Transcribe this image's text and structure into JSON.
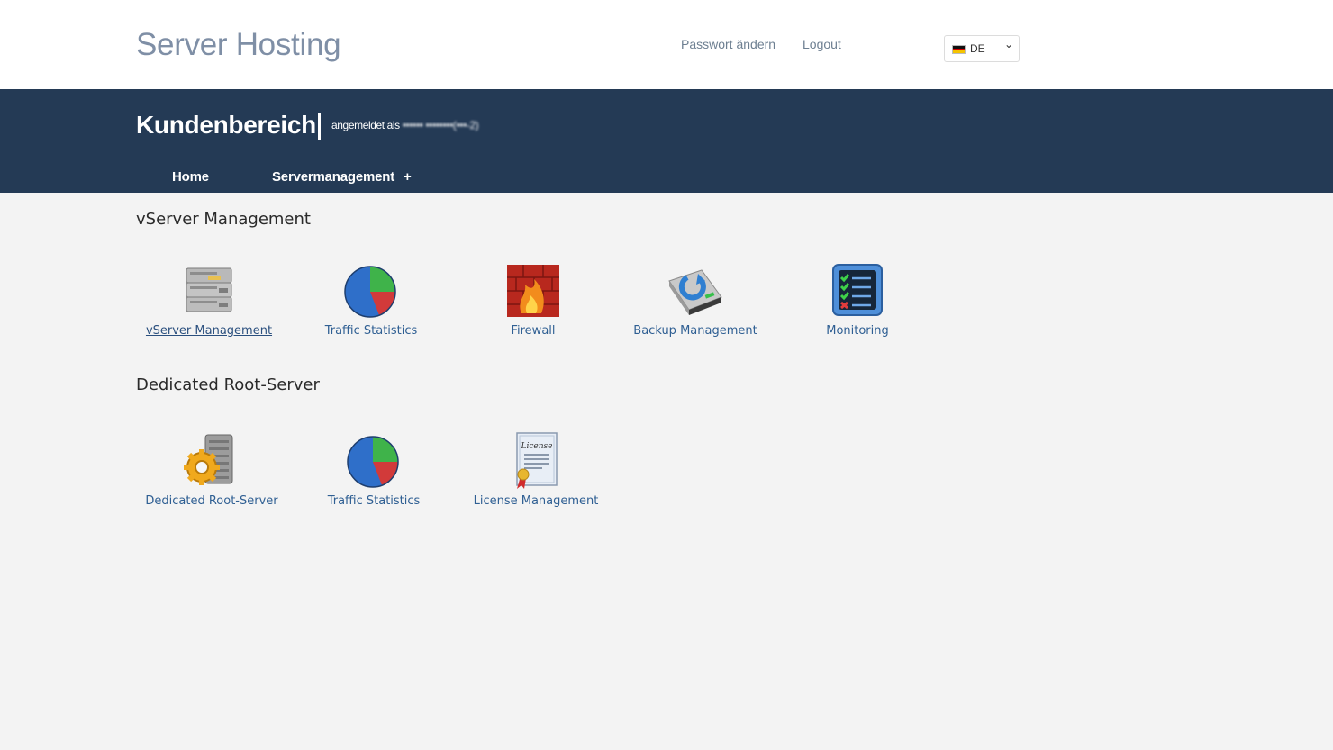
{
  "header": {
    "brand": "Server Hosting",
    "links": {
      "change_password": "Passwort ändern",
      "logout": "Logout"
    },
    "language": {
      "selected": "DE",
      "flag": "germany-flag-icon"
    }
  },
  "band": {
    "title": "Kundenbereich",
    "logged_in_prefix": "angemeldet als",
    "logged_in_user": "•••••• ••••••••(•••-2)",
    "nav": {
      "home": "Home",
      "servermanagement": "Servermanagement",
      "plus": "+"
    }
  },
  "sections": {
    "vserver": {
      "title": "vServer Management",
      "tiles": [
        {
          "label": "vServer Management",
          "icon": "server-stack-icon"
        },
        {
          "label": "Traffic Statistics",
          "icon": "pie-chart-icon"
        },
        {
          "label": "Firewall",
          "icon": "firewall-icon"
        },
        {
          "label": "Backup Management",
          "icon": "backup-drive-icon"
        },
        {
          "label": "Monitoring",
          "icon": "monitoring-checklist-icon"
        }
      ]
    },
    "dedicated": {
      "title": "Dedicated Root-Server",
      "tiles": [
        {
          "label": "Dedicated Root-Server",
          "icon": "server-gear-icon"
        },
        {
          "label": "Traffic Statistics",
          "icon": "pie-chart-icon"
        },
        {
          "label": "License Management",
          "icon": "license-certificate-icon"
        }
      ]
    }
  },
  "license_icon_text": "License",
  "colors": {
    "band": "#243a55",
    "link": "#2f5f93",
    "brand": "#7f8fa6"
  }
}
